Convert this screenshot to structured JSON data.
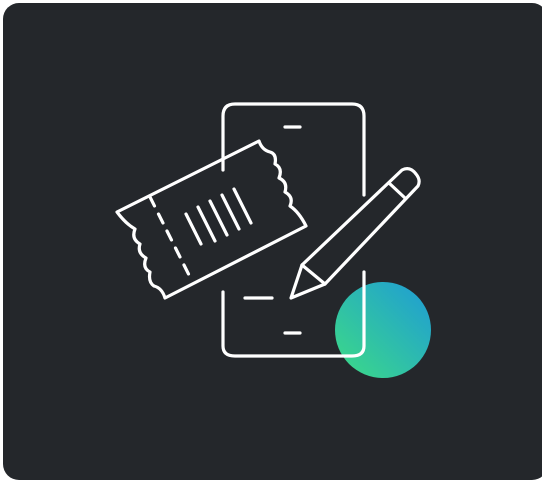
{
  "card": {
    "background": "#24272b",
    "stroke_color": "#ffffff",
    "accent_gradient": [
      "#3ddc84",
      "#1e9bd7"
    ]
  },
  "illustration": {
    "icons": [
      "phone-outline-icon",
      "ticket-icon",
      "pencil-icon",
      "gradient-dot"
    ]
  }
}
